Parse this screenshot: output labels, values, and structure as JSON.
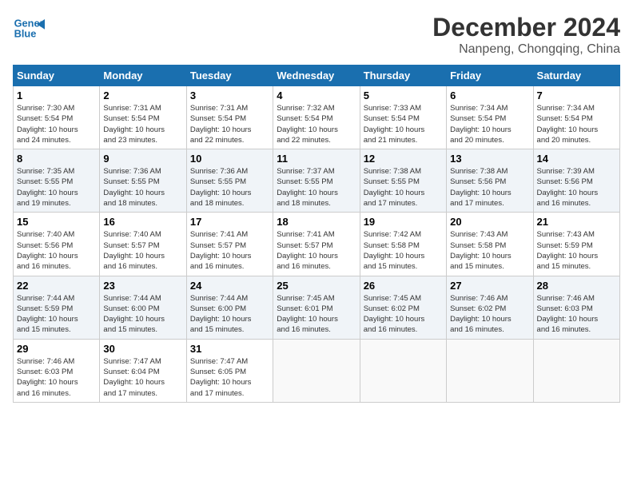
{
  "header": {
    "logo_line1": "General",
    "logo_line2": "Blue",
    "month": "December 2024",
    "location": "Nanpeng, Chongqing, China"
  },
  "days_of_week": [
    "Sunday",
    "Monday",
    "Tuesday",
    "Wednesday",
    "Thursday",
    "Friday",
    "Saturday"
  ],
  "weeks": [
    [
      {
        "day": "1",
        "sunrise": "7:30 AM",
        "sunset": "5:54 PM",
        "daylight": "10 hours and 24 minutes."
      },
      {
        "day": "2",
        "sunrise": "7:31 AM",
        "sunset": "5:54 PM",
        "daylight": "10 hours and 23 minutes."
      },
      {
        "day": "3",
        "sunrise": "7:31 AM",
        "sunset": "5:54 PM",
        "daylight": "10 hours and 22 minutes."
      },
      {
        "day": "4",
        "sunrise": "7:32 AM",
        "sunset": "5:54 PM",
        "daylight": "10 hours and 22 minutes."
      },
      {
        "day": "5",
        "sunrise": "7:33 AM",
        "sunset": "5:54 PM",
        "daylight": "10 hours and 21 minutes."
      },
      {
        "day": "6",
        "sunrise": "7:34 AM",
        "sunset": "5:54 PM",
        "daylight": "10 hours and 20 minutes."
      },
      {
        "day": "7",
        "sunrise": "7:34 AM",
        "sunset": "5:54 PM",
        "daylight": "10 hours and 20 minutes."
      }
    ],
    [
      {
        "day": "8",
        "sunrise": "7:35 AM",
        "sunset": "5:55 PM",
        "daylight": "10 hours and 19 minutes."
      },
      {
        "day": "9",
        "sunrise": "7:36 AM",
        "sunset": "5:55 PM",
        "daylight": "10 hours and 18 minutes."
      },
      {
        "day": "10",
        "sunrise": "7:36 AM",
        "sunset": "5:55 PM",
        "daylight": "10 hours and 18 minutes."
      },
      {
        "day": "11",
        "sunrise": "7:37 AM",
        "sunset": "5:55 PM",
        "daylight": "10 hours and 18 minutes."
      },
      {
        "day": "12",
        "sunrise": "7:38 AM",
        "sunset": "5:55 PM",
        "daylight": "10 hours and 17 minutes."
      },
      {
        "day": "13",
        "sunrise": "7:38 AM",
        "sunset": "5:56 PM",
        "daylight": "10 hours and 17 minutes."
      },
      {
        "day": "14",
        "sunrise": "7:39 AM",
        "sunset": "5:56 PM",
        "daylight": "10 hours and 16 minutes."
      }
    ],
    [
      {
        "day": "15",
        "sunrise": "7:40 AM",
        "sunset": "5:56 PM",
        "daylight": "10 hours and 16 minutes."
      },
      {
        "day": "16",
        "sunrise": "7:40 AM",
        "sunset": "5:57 PM",
        "daylight": "10 hours and 16 minutes."
      },
      {
        "day": "17",
        "sunrise": "7:41 AM",
        "sunset": "5:57 PM",
        "daylight": "10 hours and 16 minutes."
      },
      {
        "day": "18",
        "sunrise": "7:41 AM",
        "sunset": "5:57 PM",
        "daylight": "10 hours and 16 minutes."
      },
      {
        "day": "19",
        "sunrise": "7:42 AM",
        "sunset": "5:58 PM",
        "daylight": "10 hours and 15 minutes."
      },
      {
        "day": "20",
        "sunrise": "7:43 AM",
        "sunset": "5:58 PM",
        "daylight": "10 hours and 15 minutes."
      },
      {
        "day": "21",
        "sunrise": "7:43 AM",
        "sunset": "5:59 PM",
        "daylight": "10 hours and 15 minutes."
      }
    ],
    [
      {
        "day": "22",
        "sunrise": "7:44 AM",
        "sunset": "5:59 PM",
        "daylight": "10 hours and 15 minutes."
      },
      {
        "day": "23",
        "sunrise": "7:44 AM",
        "sunset": "6:00 PM",
        "daylight": "10 hours and 15 minutes."
      },
      {
        "day": "24",
        "sunrise": "7:44 AM",
        "sunset": "6:00 PM",
        "daylight": "10 hours and 15 minutes."
      },
      {
        "day": "25",
        "sunrise": "7:45 AM",
        "sunset": "6:01 PM",
        "daylight": "10 hours and 16 minutes."
      },
      {
        "day": "26",
        "sunrise": "7:45 AM",
        "sunset": "6:02 PM",
        "daylight": "10 hours and 16 minutes."
      },
      {
        "day": "27",
        "sunrise": "7:46 AM",
        "sunset": "6:02 PM",
        "daylight": "10 hours and 16 minutes."
      },
      {
        "day": "28",
        "sunrise": "7:46 AM",
        "sunset": "6:03 PM",
        "daylight": "10 hours and 16 minutes."
      }
    ],
    [
      {
        "day": "29",
        "sunrise": "7:46 AM",
        "sunset": "6:03 PM",
        "daylight": "10 hours and 16 minutes."
      },
      {
        "day": "30",
        "sunrise": "7:47 AM",
        "sunset": "6:04 PM",
        "daylight": "10 hours and 17 minutes."
      },
      {
        "day": "31",
        "sunrise": "7:47 AM",
        "sunset": "6:05 PM",
        "daylight": "10 hours and 17 minutes."
      },
      null,
      null,
      null,
      null
    ]
  ],
  "labels": {
    "sunrise": "Sunrise:",
    "sunset": "Sunset:",
    "daylight": "Daylight:"
  }
}
